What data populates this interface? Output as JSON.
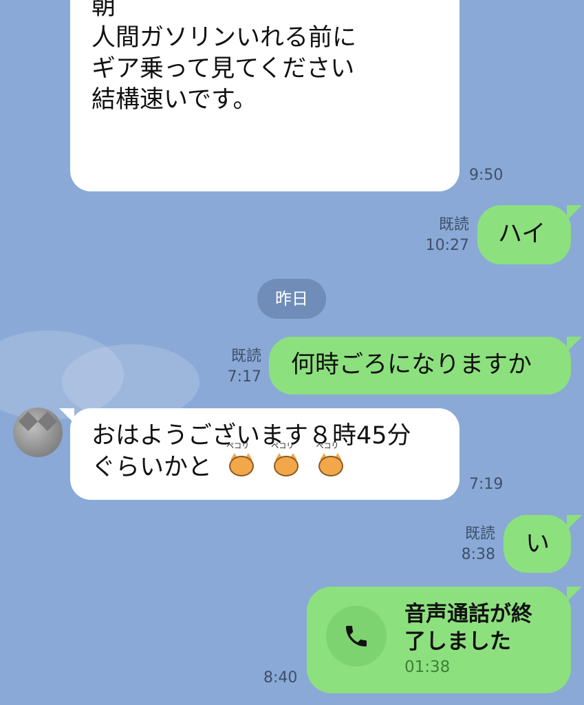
{
  "chat": {
    "msg1": {
      "lines": [
        "朝",
        "人間ガソリンいれる前に",
        "ギア乗って見てください",
        "結構速いです。"
      ],
      "time": "9:50"
    },
    "msg2": {
      "text": "ハイ",
      "read": "既読",
      "time": "10:27"
    },
    "day_separator": "昨日",
    "msg3": {
      "text": "何時ごろになりますか",
      "read": "既読",
      "time": "7:17"
    },
    "msg4": {
      "lines": [
        "おはようございます８時45分",
        "ぐらいかと"
      ],
      "sticker_labels": [
        "ペコリ",
        "ペコリ",
        "ペコリ"
      ],
      "time": "7:19"
    },
    "msg5": {
      "text": "い",
      "read": "既読",
      "time": "8:38"
    },
    "msg6": {
      "title": "音声通話が終了しました",
      "duration": "01:38",
      "time": "8:40",
      "icon": "phone-icon"
    }
  },
  "colors": {
    "background": "#8aa9d6",
    "incoming": "#ffffff",
    "outgoing": "#8de07e",
    "day_pill": "#6f8db8"
  }
}
